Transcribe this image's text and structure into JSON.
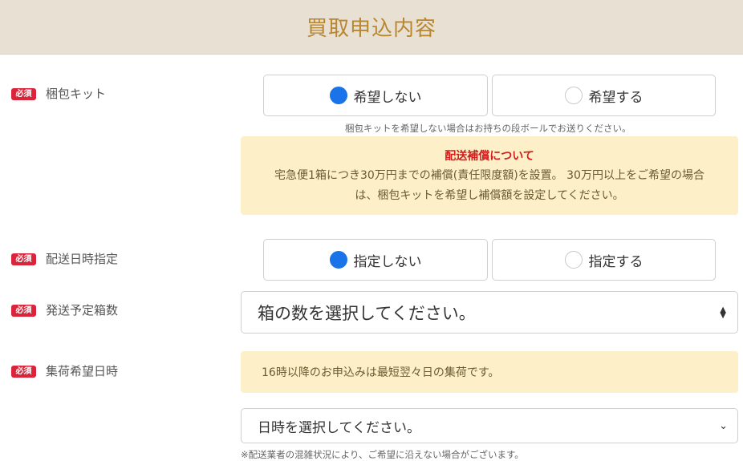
{
  "header": {
    "title": "買取申込内容"
  },
  "required_badge": "必須",
  "kit": {
    "label": "梱包キット",
    "options": [
      "希望しない",
      "希望する"
    ],
    "selected": 0,
    "note": "梱包キットを希望しない場合はお持ちの段ボールでお送りください。",
    "compensation": {
      "title": "配送補償について",
      "line1": "宅急便1箱につき30万円までの補償(責任限度額)を設置。 30万円以上をご希望の場合",
      "line2": "は、梱包キットを希望し補償額を設定してください。"
    }
  },
  "delivery_date": {
    "label": "配送日時指定",
    "options": [
      "指定しない",
      "指定する"
    ],
    "selected": 0
  },
  "box_count": {
    "label": "発送予定箱数",
    "placeholder": "箱の数を選択してください。"
  },
  "pickup": {
    "label": "集荷希望日時",
    "info": "16時以降のお申込みは最短翌々日の集荷です。",
    "placeholder": "日時を選択してください。",
    "note": "※配送業者の混雑状況により、ご希望に沿えない場合がございます。"
  },
  "colors": {
    "accent": "#1a73e8",
    "required": "#d9243a",
    "header_bg": "#e8e0d2",
    "header_text": "#b8862e",
    "info_bg": "#fdf0c8"
  }
}
